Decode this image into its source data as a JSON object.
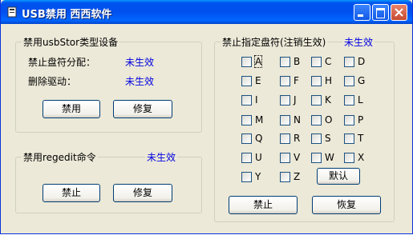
{
  "window": {
    "title": "USB禁用  西西软件"
  },
  "usb_group": {
    "label": "禁用usbStor类型设备",
    "row1_label": "禁止盘符分配：",
    "row1_status": "未生效",
    "row2_label": "删除驱动：",
    "row2_status": "未生效",
    "disable_button": "禁用",
    "repair_button": "修复"
  },
  "regedit_group": {
    "label": "禁用regedit命令",
    "status": "未生效",
    "disable_button": "禁止",
    "repair_button": "修复"
  },
  "drive_group": {
    "label": "禁止指定盘符(注销生效)",
    "status": "未生效",
    "letters": [
      "A",
      "B",
      "C",
      "D",
      "E",
      "F",
      "H",
      "G",
      "I",
      "J",
      "K",
      "L",
      "M",
      "N",
      "O",
      "P",
      "Q",
      "R",
      "S",
      "T",
      "U",
      "V",
      "W",
      "X",
      "Y",
      "Z"
    ],
    "default_button": "默认",
    "disable_button": "禁止",
    "restore_button": "恢复"
  }
}
